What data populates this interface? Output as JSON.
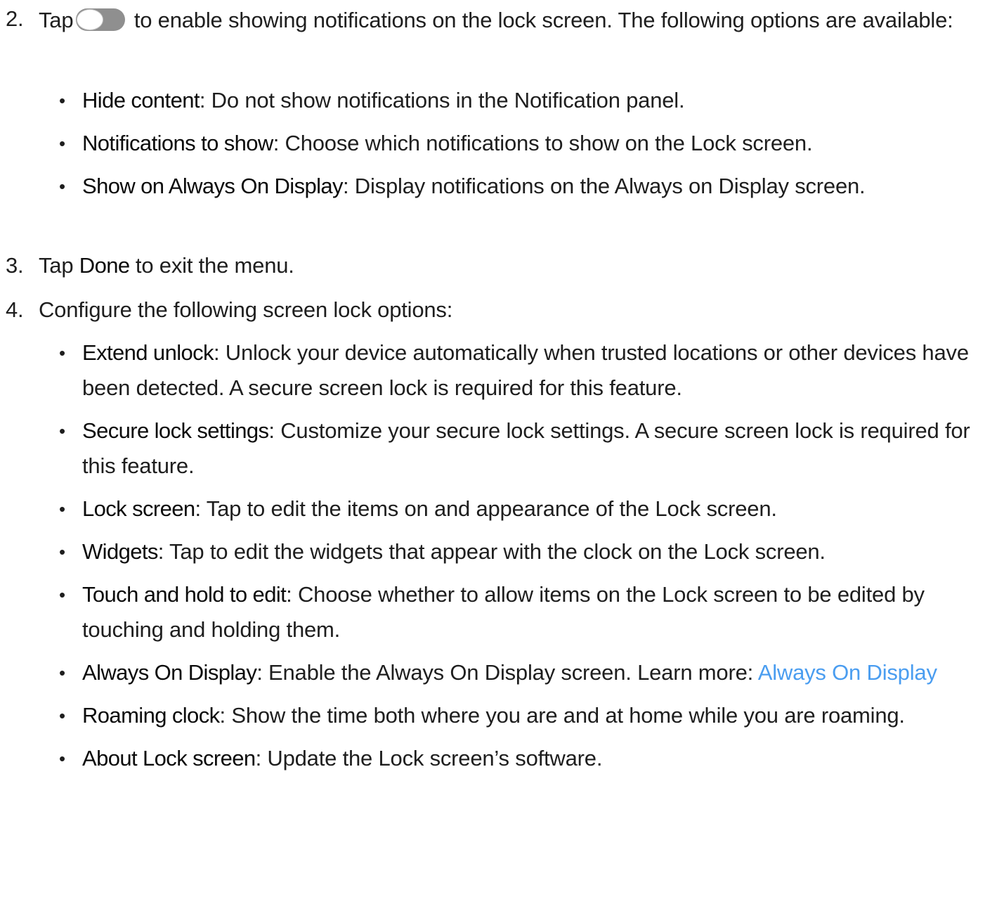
{
  "steps": [
    {
      "number": "2.",
      "text_before_toggle": "Tap",
      "text_after_toggle": "to enable showing notifications on the lock screen. The following options are available:",
      "bullets": [
        {
          "term": "Hide content",
          "text": ": Do not show notifications in the Notification panel."
        },
        {
          "term": "Notifications to show",
          "text": ": Choose which notifications to show on the Lock screen."
        },
        {
          "term": "Show on Always On Display",
          "text": ": Display notifications on the Always on Display screen."
        }
      ]
    },
    {
      "number": "3.",
      "text_before": "Tap ",
      "term": "Done",
      "text_after": " to exit the menu."
    },
    {
      "number": "4.",
      "text": "Configure the following screen lock options:",
      "bullets": [
        {
          "term": "Extend unlock",
          "text": ": Unlock your device automatically when trusted locations or other devices have been detected. A secure screen lock is required for this feature."
        },
        {
          "term": "Secure lock settings",
          "text": ": Customize your secure lock settings. A secure screen lock is required for this feature."
        },
        {
          "term": "Lock screen",
          "text": ": Tap to edit the items on and appearance of the Lock screen."
        },
        {
          "term": "Widgets",
          "text": ": Tap to edit the widgets that appear with the clock on the Lock screen."
        },
        {
          "term": "Touch and hold to edit",
          "text": ": Choose whether to allow items on the Lock screen to be edited by touching and holding them."
        },
        {
          "term": "Always On Display",
          "text": ": Enable the Always On Display screen. Learn more: ",
          "link": "Always On Display"
        },
        {
          "term": "Roaming clock",
          "text": ": Show the time both where you are and at home while you are roaming."
        },
        {
          "term": "About Lock screen",
          "text": ": Update the Lock screen’s software."
        }
      ]
    }
  ],
  "bullet_glyph": "•",
  "colors": {
    "text": "#1e1e1e",
    "link": "#4a9df0",
    "toggle_track": "#8f8f8f"
  },
  "icons": {
    "toggle": "toggle-switch-icon"
  }
}
